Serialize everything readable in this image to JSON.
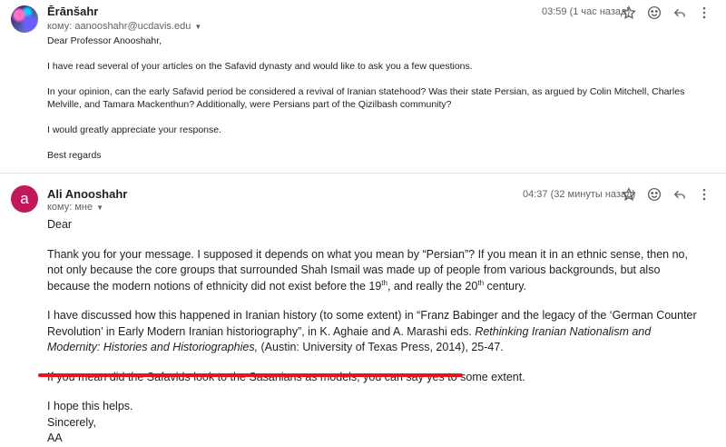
{
  "message1": {
    "sender": "Ērānšahr",
    "to": "кому: aanooshahr@ucdavis.edu",
    "time": "03:59 (1 час назад)",
    "greeting": "Dear Professor Anooshahr,",
    "p1": "I have read several of your articles on the Safavid dynasty and would like to ask you a few questions.",
    "p2": "In your opinion, can the early Safavid period be considered a revival of Iranian statehood? Was their state Persian, as argued by Colin Mitchell, Charles Melville, and Tamara Mackenthun? Additionally, were Persians part of the Qizilbash community?",
    "p3": "I would greatly appreciate your response.",
    "sign": "Best regards"
  },
  "message2": {
    "avatar_letter": "a",
    "avatar_color": "#c2185b",
    "sender": "Ali Anooshahr",
    "to": "кому: мне",
    "time": "04:37 (32 минуты назад)",
    "greeting": "Dear",
    "p1a": "Thank you for your message. I supposed it depends on what you mean by “Persian”? If you mean it in an ethnic sense, then no, not only because the core groups that surrounded Shah Ismail was made up of people from various backgrounds, but also because the modern notions of ethnicity did not exist before the 19",
    "p1_sup1": "th",
    "p1b": ", and really the 20",
    "p1_sup2": "th",
    "p1c": " century.",
    "p2a": "I have discussed how this happened in Iranian history (to some extent) in “Franz Babinger and the legacy of the ‘German Counter Revolution’ in Early Modern Iranian historiography”, in K. Aghaie and A. Marashi eds. ",
    "p2_italic": "Rethinking Iranian Nationalism and Modernity: Histories and Historiographies,",
    "p2b": " (Austin: University of Texas Press, 2014), 25-47.",
    "p3": "If you mean did the Safavids look to the Sasanians as models, you can say yes to some extent.",
    "closing1": "I hope this helps.",
    "closing2": "Sincerely,",
    "closing3": "AA"
  },
  "icons": [
    "star-icon",
    "emoji-icon",
    "reply-icon",
    "more-vert-icon"
  ],
  "highlight_color": "#e8141b"
}
